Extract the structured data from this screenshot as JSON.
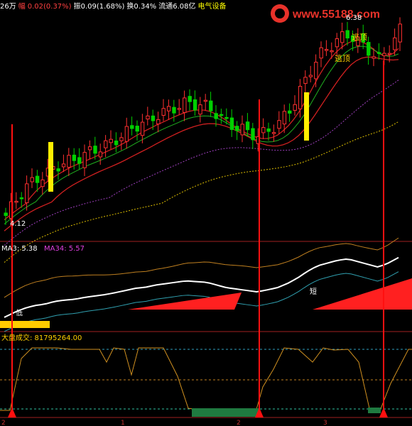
{
  "header": {
    "volume": "26万",
    "change_label": "幅",
    "change_value": "0.02(0.37%)",
    "amplitude": "振0.09(1.68%)",
    "turnover": "换0.34%",
    "float_cap": "流通6.08亿",
    "sector": "电气设备",
    "colors": {
      "volume": "#ffffff",
      "change": "#ff4040",
      "amplitude": "#ffffff",
      "sector": "#ffff00"
    }
  },
  "watermark": {
    "text": "www.55188.com",
    "color": "#e8322a"
  },
  "panel_price": {
    "high_label": "6.38",
    "low_label": "4.12",
    "top_call_1": "逃顶",
    "top_call_2": "逃顶"
  },
  "panel_mid": {
    "ma_a_label": "MA3: 5.38",
    "ma_b_label": "MA34: 5.57",
    "mark_buy": "低",
    "mark_sell": "短"
  },
  "panel_bottom": {
    "index_label": "大盘成交: 81795264.00"
  },
  "x_ticks": [
    "2",
    "1",
    "2",
    "3"
  ],
  "colors": {
    "up": "#ff3030",
    "down": "#00d000",
    "ma_red": "#d02020",
    "ma_green": "#20b020",
    "ma_purple": "#a040c0",
    "ma_yellow": "#e0c000",
    "osc": "#d09020",
    "signal": "#ff1010"
  },
  "chart_data": [
    {
      "type": "candlestick",
      "title": "",
      "annotations": [
        "6.38",
        "4.12",
        "逃顶",
        "逃顶"
      ],
      "series": [
        {
          "values": [
            4.12,
            4.3,
            4.45,
            4.55,
            4.6,
            4.7,
            4.75,
            4.78,
            4.85,
            4.9,
            4.95,
            5.02,
            5.1,
            5.18,
            5.22,
            5.3,
            5.35,
            5.4,
            5.45,
            5.42,
            5.4,
            5.3,
            5.2,
            5.15,
            5.1,
            5.05,
            5.12,
            5.2,
            5.35,
            5.55,
            5.8,
            6.0,
            6.1,
            6.2,
            6.25,
            6.15,
            6.05,
            5.95,
            6.1,
            6.3
          ]
        }
      ]
    },
    {
      "type": "line",
      "title": "",
      "series": [
        {
          "name": "MA3",
          "values": [
            5.38
          ]
        },
        {
          "name": "MA34",
          "values": [
            5.57
          ]
        }
      ]
    },
    {
      "type": "line",
      "title": "大盘成交",
      "series": [
        {
          "name": "大盘成交",
          "values": [
            81795264.0
          ]
        }
      ]
    }
  ]
}
